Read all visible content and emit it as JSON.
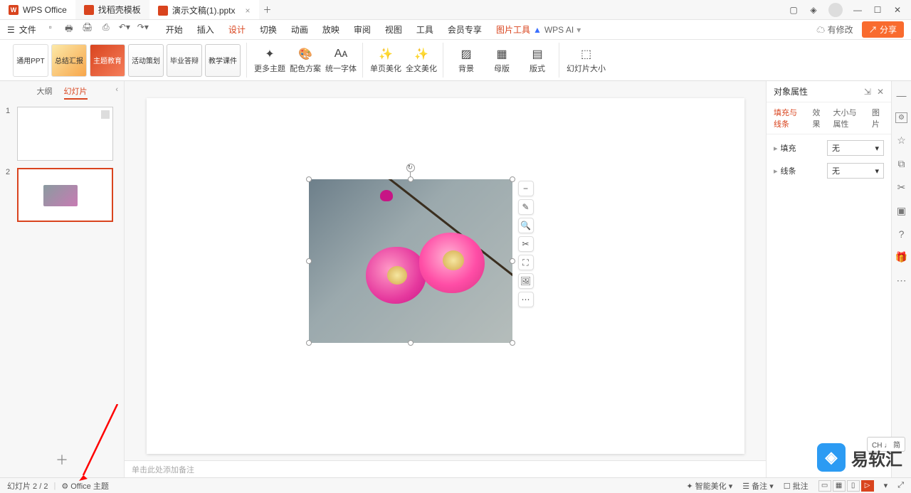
{
  "titlebar": {
    "app_name": "WPS Office",
    "tabs": [
      {
        "label": "找稻壳模板"
      },
      {
        "label": "演示文稿(1).pptx",
        "active": true
      }
    ]
  },
  "menubar": {
    "file": "文件",
    "tabs": [
      "开始",
      "插入",
      "设计",
      "切换",
      "动画",
      "放映",
      "审阅",
      "视图",
      "工具",
      "会员专享"
    ],
    "active_tab": "设计",
    "context_tab": "图片工具",
    "ai_label": "WPS AI",
    "changes": "有修改",
    "share": "分享"
  },
  "ribbon": {
    "templates": [
      {
        "label": "通用PPT"
      },
      {
        "label": "总结汇报"
      },
      {
        "label": "主题教育"
      },
      {
        "label": "活动策划"
      },
      {
        "label": "毕业答辩"
      },
      {
        "label": "教学课件"
      }
    ],
    "buttons": {
      "more_themes": "更多主题",
      "color_scheme": "配色方案",
      "uniform_font": "统一字体",
      "page_beautify": "单页美化",
      "full_beautify": "全文美化",
      "background": "背景",
      "master": "母版",
      "layout": "版式",
      "slide_size": "幻灯片大小"
    }
  },
  "slidepanel": {
    "tab_outline": "大纲",
    "tab_slides": "幻灯片",
    "slides": [
      {
        "num": "1"
      },
      {
        "num": "2",
        "selected": true
      }
    ]
  },
  "float_tools": [
    "−",
    "✎",
    "🔍",
    "✂",
    "⛶",
    "🖼",
    "⋯"
  ],
  "notes_placeholder": "单击此处添加备注",
  "rightpanel": {
    "title": "对象属性",
    "tabs": [
      "填充与线条",
      "效果",
      "大小与属性",
      "图片"
    ],
    "active_tab": "填充与线条",
    "fill_label": "填充",
    "fill_value": "无",
    "line_label": "线条",
    "line_value": "无"
  },
  "statusbar": {
    "slide_info": "幻灯片 2 / 2",
    "theme": "Office 主题",
    "smart_beautify": "智能美化",
    "notes": "备注",
    "comments": "批注"
  },
  "ime": "CH ♩ 简",
  "watermark": "易软汇"
}
